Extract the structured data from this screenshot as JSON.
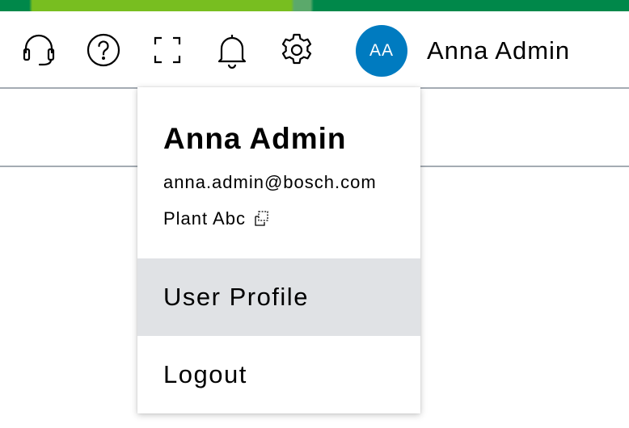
{
  "header": {
    "icons": [
      {
        "name": "headset-icon"
      },
      {
        "name": "help-icon"
      },
      {
        "name": "fullscreen-icon"
      },
      {
        "name": "bell-icon"
      },
      {
        "name": "gear-icon"
      }
    ],
    "avatar_initials": "AA",
    "user_name": "Anna Admin"
  },
  "dropdown": {
    "name": "Anna Admin",
    "email": "anna.admin@bosch.com",
    "plant": "Plant Abc",
    "plant_icon": "switch-icon",
    "items": [
      {
        "label": "User Profile",
        "highlighted": true
      },
      {
        "label": "Logout",
        "highlighted": false
      }
    ]
  },
  "colors": {
    "avatar_bg": "#007bc0",
    "highlight_bg": "#e0e2e5",
    "divider": "#a4abb3",
    "brand_green": "#78be20",
    "brand_dark_green": "#00884a"
  }
}
